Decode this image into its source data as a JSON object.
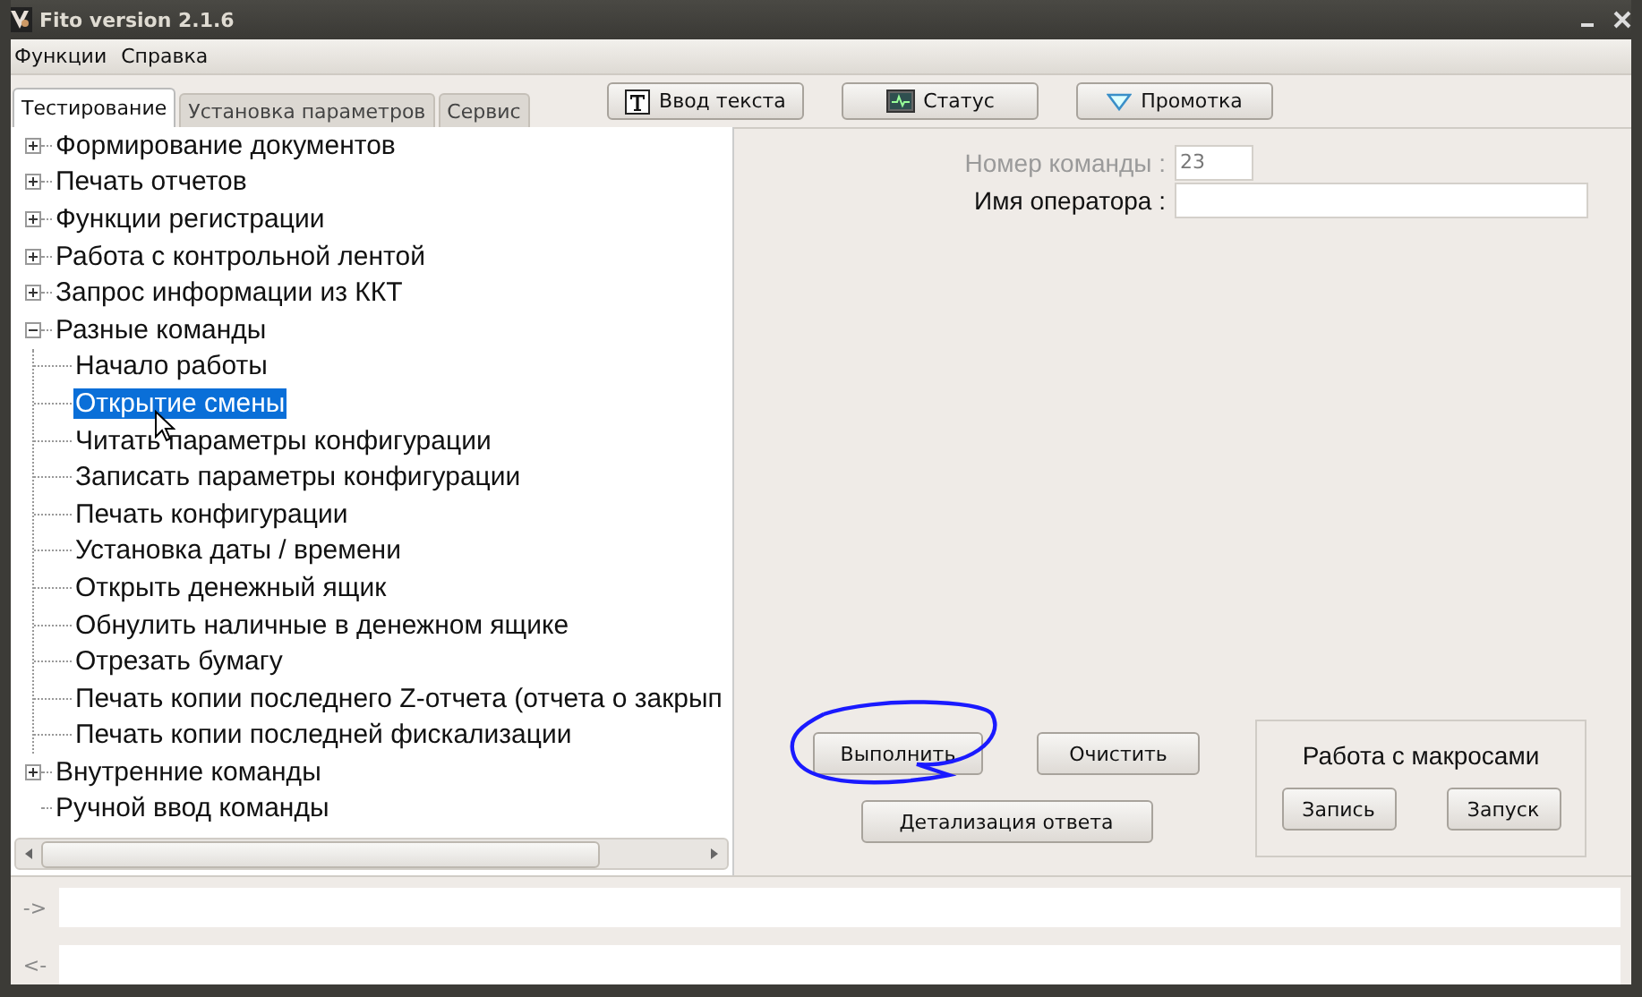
{
  "window": {
    "title": "Fito version 2.1.6"
  },
  "menu": [
    "Функции",
    "Справка"
  ],
  "tabs": [
    {
      "label": "Тестирование",
      "selected": true
    },
    {
      "label": "Установка параметров",
      "selected": false
    },
    {
      "label": "Сервис",
      "selected": false
    }
  ],
  "toolbar": [
    {
      "label": "Ввод текста",
      "kind": "text"
    },
    {
      "label": "Статус",
      "kind": "status"
    },
    {
      "label": "Промотка",
      "kind": "feed"
    }
  ],
  "tree": [
    {
      "label": "Формирование документов",
      "expanded": false,
      "selected": false
    },
    {
      "label": "Печать отчетов",
      "expanded": false,
      "selected": false
    },
    {
      "label": "Функции регистрации",
      "expanded": false,
      "selected": false
    },
    {
      "label": "Работа с контрольной лентой",
      "expanded": false,
      "selected": false
    },
    {
      "label": "Запрос информации из ККТ",
      "expanded": false,
      "selected": false
    },
    {
      "label": "Разные команды",
      "expanded": true,
      "selected": false,
      "children": [
        {
          "label": "Начало работы",
          "selected": false
        },
        {
          "label": "Открытие смены",
          "selected": true
        },
        {
          "label": "Читать параметры конфигурации",
          "selected": false
        },
        {
          "label": "Записать параметры конфигурации",
          "selected": false
        },
        {
          "label": "Печать конфигурации",
          "selected": false
        },
        {
          "label": "Установка даты / времени",
          "selected": false
        },
        {
          "label": "Открыть денежный ящик",
          "selected": false
        },
        {
          "label": "Обнулить наличные в денежном ящике",
          "selected": false
        },
        {
          "label": "Отрезать бумагу",
          "selected": false
        },
        {
          "label": "Печать копии последнего Z-отчета (отчета о закрып",
          "selected": false
        },
        {
          "label": "Печать копии последней фискализации",
          "selected": false
        }
      ]
    },
    {
      "label": "Внутренние команды",
      "expanded": false,
      "selected": false
    },
    {
      "label": "Ручной ввод команды",
      "selected": false
    }
  ],
  "form": [
    {
      "label": "Номер команды :",
      "value": "23",
      "disabled": true
    },
    {
      "label": "Имя оператора :",
      "disabled": false
    }
  ],
  "actions": {
    "execute": "Выполнить",
    "clear": "Очистить",
    "details": "Детализация ответа"
  },
  "macros": {
    "title": "Работа с макросами",
    "buttons": [
      "Запись",
      "Запуск"
    ]
  },
  "console": [
    {
      "prompt": "->"
    },
    {
      "prompt": "<-"
    }
  ]
}
